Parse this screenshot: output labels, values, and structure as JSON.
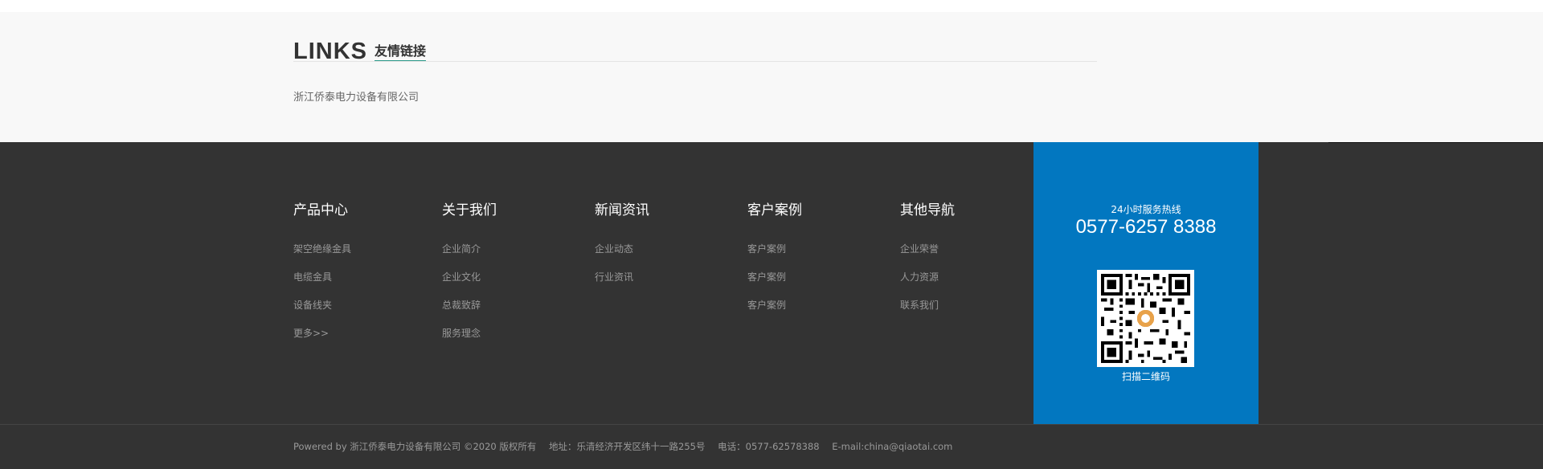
{
  "links": {
    "title_en": "LINKS",
    "title_cn": "友情链接",
    "items": [
      "浙江侨泰电力设备有限公司"
    ]
  },
  "nav": {
    "columns": [
      {
        "title": "产品中心",
        "links": [
          "架空绝缘金具",
          "电缆金具",
          "设备线夹",
          "更多>>"
        ]
      },
      {
        "title": "关于我们",
        "links": [
          "企业简介",
          "企业文化",
          "总裁致辞",
          "服务理念"
        ]
      },
      {
        "title": "新闻资讯",
        "links": [
          "企业动态",
          "行业资讯"
        ]
      },
      {
        "title": "客户案例",
        "links": [
          "客户案例",
          "客户案例",
          "客户案例"
        ]
      },
      {
        "title": "其他导航",
        "links": [
          "企业荣誉",
          "人力资源",
          "联系我们"
        ]
      }
    ]
  },
  "service": {
    "hotline_label": "24小时服务热线",
    "hotline_number": "0577-6257 8388",
    "qr_caption": "扫描二维码",
    "qr_icon": "qr-code-icon"
  },
  "footer": {
    "powered": "Powered by 浙江侨泰电力设备有限公司 ©2020 版权所有",
    "address": "地址：乐清经济开发区纬十一路255号",
    "phone": "电话：0577-62578388",
    "email": "E-mail:china@qiaotai.com"
  },
  "colors": {
    "links_bg": "#f8f8f8",
    "footer_bg": "#333333",
    "service_bg": "#0277c0",
    "accent_underline": "#2a9a8a"
  }
}
